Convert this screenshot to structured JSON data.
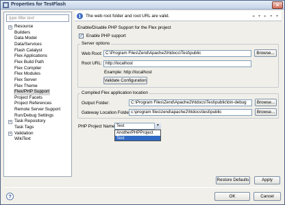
{
  "window": {
    "title": "Properties for TestFlash"
  },
  "filter": {
    "placeholder": "type filter text"
  },
  "tree": {
    "items": [
      {
        "label": "Resource",
        "expandable": true
      },
      {
        "label": "Builders",
        "expandable": false
      },
      {
        "label": "Data Model",
        "expandable": false
      },
      {
        "label": "Data/Services",
        "expandable": false
      },
      {
        "label": "Flash Catalyst",
        "expandable": false
      },
      {
        "label": "Flex Applications",
        "expandable": false
      },
      {
        "label": "Flex Build Path",
        "expandable": false
      },
      {
        "label": "Flex Compiler",
        "expandable": false
      },
      {
        "label": "Flex Modules",
        "expandable": false
      },
      {
        "label": "Flex Server",
        "expandable": false
      },
      {
        "label": "Flex Theme",
        "expandable": false
      },
      {
        "label": "Flex/PHP Support",
        "expandable": false,
        "selected": true
      },
      {
        "label": "Project Facets",
        "expandable": false
      },
      {
        "label": "Project References",
        "expandable": false
      },
      {
        "label": "Remote Server Support",
        "expandable": false
      },
      {
        "label": "Run/Debug Settings",
        "expandable": false
      },
      {
        "label": "Task Repository",
        "expandable": true
      },
      {
        "label": "Task Tags",
        "expandable": false
      },
      {
        "label": "Validation",
        "expandable": true
      },
      {
        "label": "WikiText",
        "expandable": false
      }
    ]
  },
  "info": {
    "message": "The web root folder and root URL are valid."
  },
  "php": {
    "heading": "Enable/Disable PHP Support for the Flex project",
    "enable_label": "Enable PHP support",
    "enabled": true
  },
  "server_options": {
    "title": "Server options",
    "web_root_label": "Web Root:",
    "web_root_value": "C:\\Program Files\\Zend\\Apache2\\htdocs\\Test\\public",
    "browse_label": "Browse...",
    "root_url_label": "Root URL:",
    "root_url_value": "http://localhost",
    "example_text": "Example: http://localhost",
    "validate_label": "Validate Configuration"
  },
  "compiled": {
    "title": "Compiled Flex application location",
    "output_label": "Output Folder:",
    "output_value": "C:\\Program Files\\Zend\\Apache2\\htdocs\\Test\\public\\bin-debug",
    "gateway_label": "Gateway Location Folder:",
    "gateway_value": "c:\\program files\\zend\\apache2\\htdocs\\test\\public",
    "browse_label": "Browse..."
  },
  "project_name": {
    "label": "PHP Project Name:",
    "selected": "Test",
    "options": [
      "AnotherPHPProject",
      "Test"
    ]
  },
  "buttons": {
    "restore": "Restore Defaults",
    "apply": "Apply",
    "ok": "OK",
    "cancel": "Cancel"
  },
  "colors": {
    "selection": "#316ac5",
    "title_bar": "#c4d3e7"
  }
}
